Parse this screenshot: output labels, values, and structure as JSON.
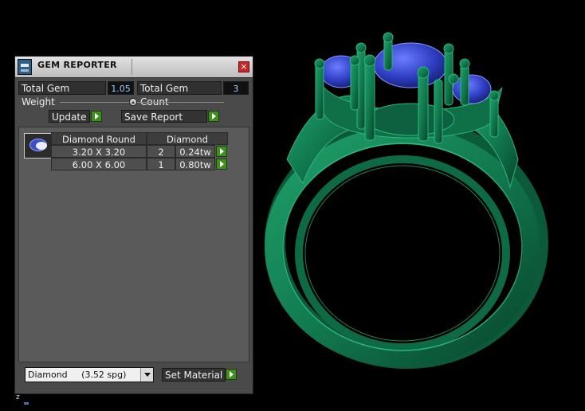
{
  "window": {
    "title": "GEM REPORTER",
    "close_glyph": "×"
  },
  "summary": {
    "total_weight_label": "Total Gem Weight",
    "total_weight_value": "1.05",
    "total_count_label": "Total Gem Count",
    "total_count_value": "3"
  },
  "actions": {
    "update_label": "Update",
    "save_report_label": "Save Report"
  },
  "gem_table": {
    "headers": [
      "Diamond Round",
      "Diamond"
    ],
    "rows": [
      {
        "size": "3.20 X 3.20",
        "count": "2",
        "weight": "0.24tw"
      },
      {
        "size": "6.00 X 6.00",
        "count": "1",
        "weight": "0.80tw"
      }
    ]
  },
  "material": {
    "selected": "Diamond     (3.52 spg)",
    "set_label": "Set Material"
  },
  "viewport": {
    "axis_label": "z"
  },
  "icons": {
    "app": "gem-reporter-app-icon",
    "close": "close-icon",
    "go": "play-arrow-icon",
    "gem": "round-gem-thumbnail-icon"
  },
  "colors": {
    "ring_metal": "#117a4f",
    "gem_blue": "#2f3ec4",
    "panel_bg": "#4a4a4a",
    "value_text": "#9bd0ff",
    "go_button": "#3f8f1e"
  }
}
